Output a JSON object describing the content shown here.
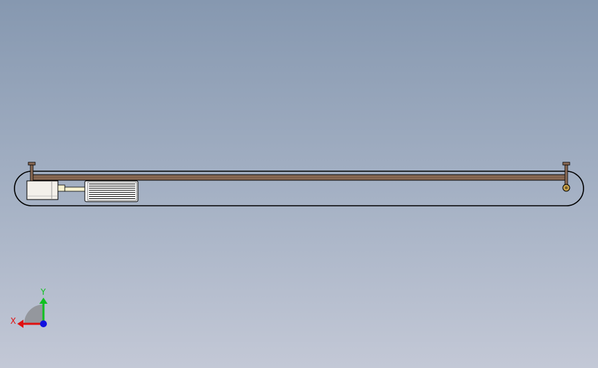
{
  "scene": {
    "model": "conveyor-belt-assembly",
    "view": "front"
  },
  "colors": {
    "belt_rail": "#8a6a55",
    "belt_outline": "#000000",
    "motor_body": "#ffffff",
    "gearbox": "#f3f0ea",
    "coupling": "#f7f2cf",
    "axis_x": "#e01010",
    "axis_y": "#10c020",
    "axis_z": "#1010e0"
  },
  "triad": {
    "x_label": "X",
    "y_label": "Y"
  }
}
